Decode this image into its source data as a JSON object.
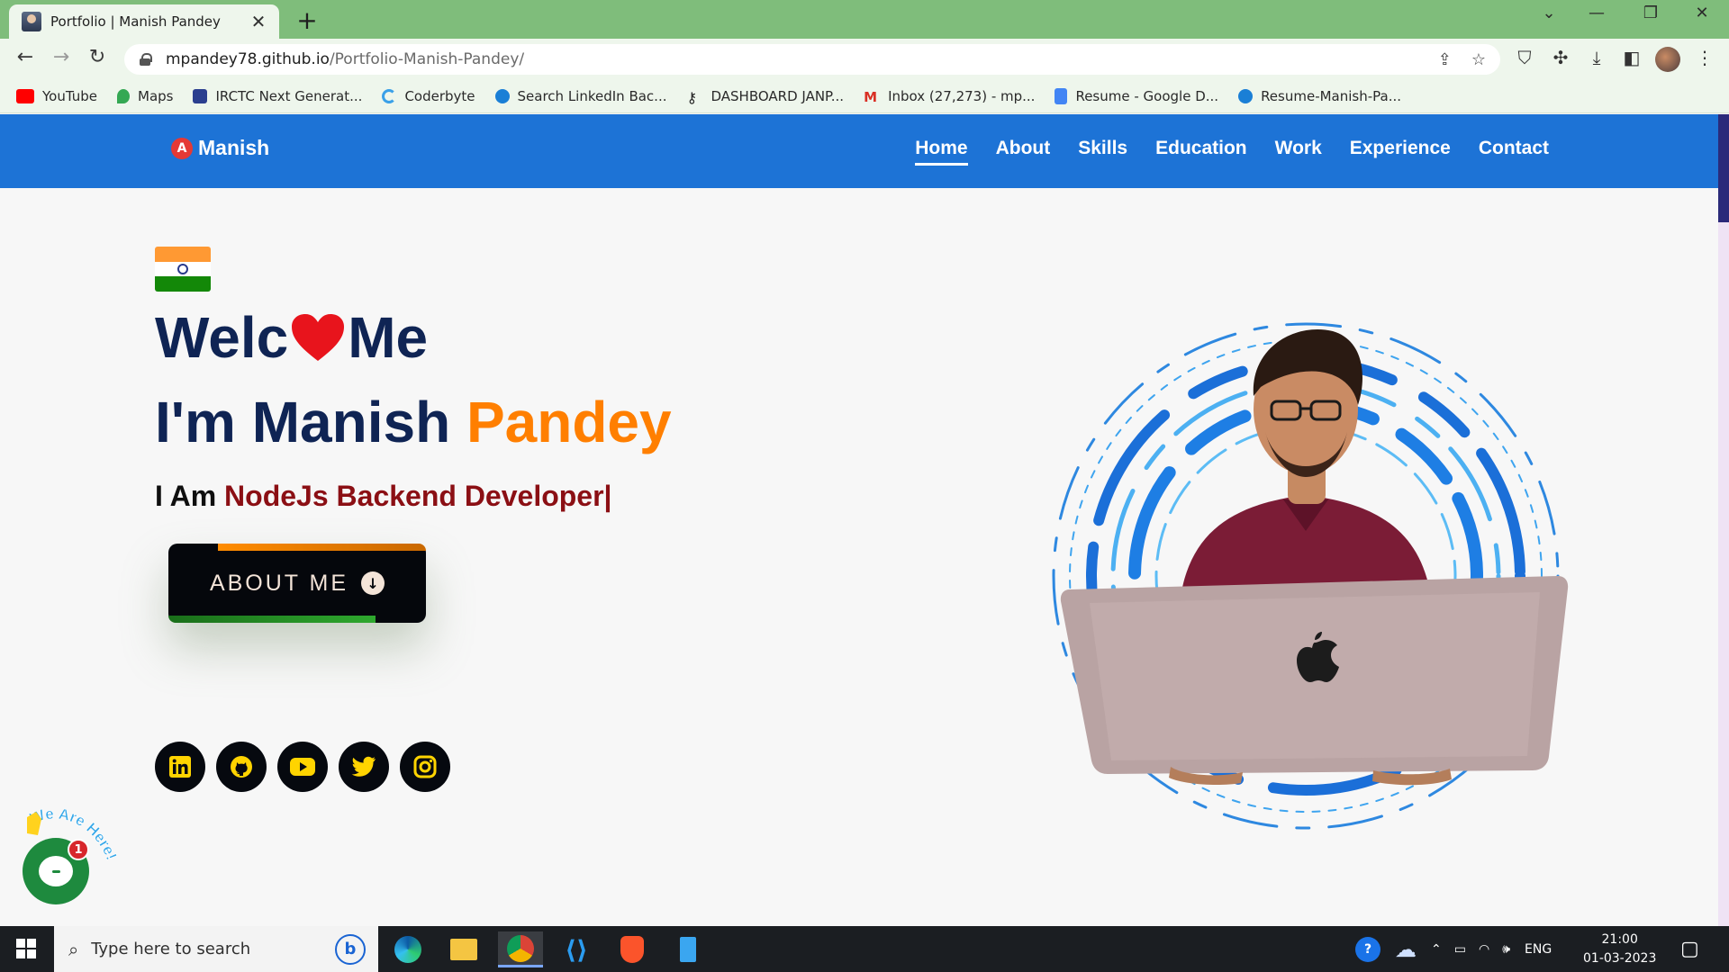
{
  "browser": {
    "tab_title": "Portfolio | Manish Pandey",
    "tab_close": "✕",
    "new_tab": "+",
    "url_host": "mpandey78.github.io",
    "url_path": "/Portfolio-Manish-Pandey/",
    "window_controls": {
      "tab_search": "⌄",
      "minimize": "—",
      "restore": "❐",
      "close": "✕"
    },
    "nav": {
      "back": "←",
      "forward": "→",
      "reload": "↻"
    },
    "bookmarks": [
      {
        "label": "YouTube",
        "icon": "youtube-icon",
        "color": "#ff0000"
      },
      {
        "label": "Maps",
        "icon": "maps-icon",
        "color": "#34a853"
      },
      {
        "label": "IRCTC Next Generat...",
        "icon": "irctc-icon",
        "color": "#2b3f8f"
      },
      {
        "label": "Coderbyte",
        "icon": "coderbyte-icon",
        "color": "#3aa0e8"
      },
      {
        "label": "Search LinkedIn Bac...",
        "icon": "globe-icon",
        "color": "#1a7fd6"
      },
      {
        "label": "DASHBOARD JANP...",
        "icon": "key-icon",
        "color": "#222222"
      },
      {
        "label": "Inbox (27,273) - mp...",
        "icon": "gmail-icon",
        "color": "#d93025"
      },
      {
        "label": "Resume - Google D...",
        "icon": "docs-icon",
        "color": "#4285f4"
      },
      {
        "label": "Resume-Manish-Pa...",
        "icon": "globe-icon",
        "color": "#1a7fd6"
      }
    ]
  },
  "site": {
    "logo_badge": "A",
    "logo_text": "Manish",
    "menu": [
      {
        "label": "Home",
        "active": true
      },
      {
        "label": "About",
        "active": false
      },
      {
        "label": "Skills",
        "active": false
      },
      {
        "label": "Education",
        "active": false
      },
      {
        "label": "Work",
        "active": false
      },
      {
        "label": "Experience",
        "active": false
      },
      {
        "label": "Contact",
        "active": false
      }
    ],
    "accent_color": "#1d73d6"
  },
  "hero": {
    "welcome_pre": "Welc",
    "welcome_post": "Me",
    "name_pre": "I'm Manish ",
    "name_accent": "Pandey",
    "role_pre": "I Am ",
    "role_text": "NodeJs Backend Developer|",
    "about_button": "ABOUT ME",
    "about_arrow": "↓",
    "socials": [
      "linkedin-icon",
      "github-icon",
      "youtube-icon",
      "twitter-icon",
      "instagram-icon"
    ]
  },
  "chat_widget": {
    "tagline": "We Are Here!",
    "badge_count": "1"
  },
  "taskbar": {
    "search_placeholder": "Type here to search",
    "bing_label": "b",
    "language": "ENG",
    "time": "21:00",
    "date": "01-03-2023"
  }
}
